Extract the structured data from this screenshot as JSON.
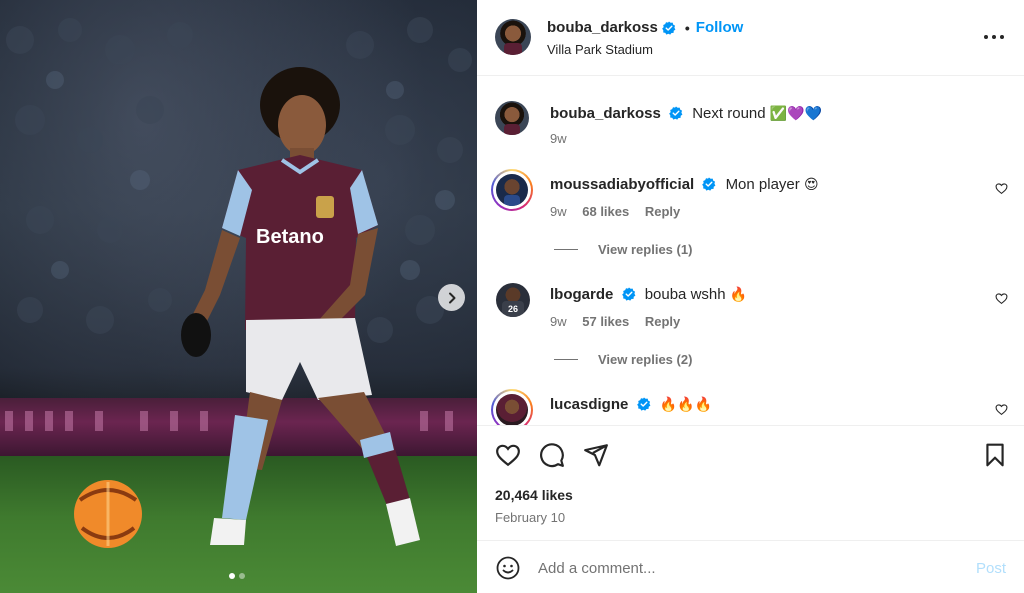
{
  "post": {
    "author": "bouba_darkoss",
    "follow_label": "Follow",
    "separator": "•",
    "location": "Villa Park Stadium",
    "jersey_sponsor": "Betano",
    "carousel_total": 2,
    "carousel_active": 1
  },
  "caption": {
    "username": "bouba_darkoss",
    "text": "Next round",
    "emojis": "✅💜💙",
    "age": "9w"
  },
  "comments": [
    {
      "username": "moussadiabyofficial",
      "text": "Mon player",
      "emoji": "😍",
      "age": "9w",
      "likes": "68 likes",
      "reply_label": "Reply",
      "view_replies": "View replies (1)",
      "story_ring": true
    },
    {
      "username": "lbogarde",
      "text": "bouba wshh",
      "emoji": "🔥",
      "age": "9w",
      "likes": "57 likes",
      "reply_label": "Reply",
      "view_replies": "View replies (2)",
      "story_ring": false
    },
    {
      "username": "lucasdigne",
      "text": "",
      "emoji": "🔥🔥🔥",
      "story_ring": true
    }
  ],
  "stats": {
    "likes": "20,464 likes",
    "date": "February 10"
  },
  "composer": {
    "placeholder": "Add a comment...",
    "post_label": "Post"
  },
  "icons": {
    "like": "heart-icon",
    "comment": "comment-icon",
    "share": "share-icon",
    "save": "bookmark-icon",
    "more": "more-dots-icon",
    "next": "chevron-right-icon",
    "emoji": "smiley-icon",
    "verified": "verified-badge-icon"
  },
  "colors": {
    "accent": "#0095f6",
    "muted": "#737373",
    "post_disabled": "#b2dffc",
    "verified": "#0095f6"
  }
}
